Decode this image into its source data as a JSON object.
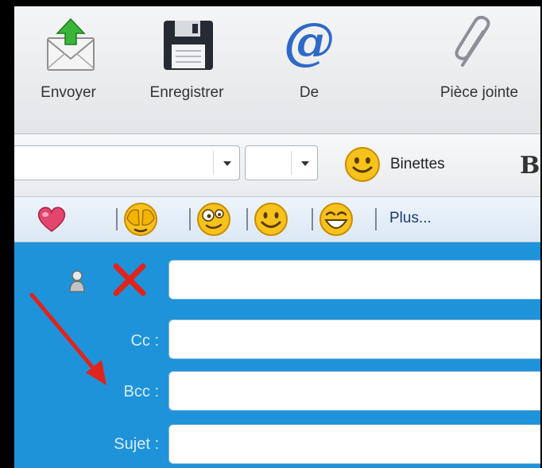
{
  "toolbar": {
    "buttons": [
      {
        "label": "Envoyer",
        "icon": "send-envelope-icon"
      },
      {
        "label": "Enregistrer",
        "icon": "floppy-disk-icon"
      },
      {
        "label": "De",
        "icon": "at-sign-icon"
      },
      {
        "label": "Pièce jointe",
        "icon": "paperclip-icon"
      }
    ]
  },
  "format_bar": {
    "font_family_value": "",
    "font_size_value": "",
    "emoticons_label": "Binettes",
    "bold_label": "B"
  },
  "emoji_bar": {
    "emojis": [
      "heart",
      "hands-over-eyes",
      "silly-face",
      "smile",
      "laughing"
    ],
    "more_label": "Plus..."
  },
  "compose": {
    "to_label": "",
    "cc_label": "Cc :",
    "bcc_label": "Bcc :",
    "subject_label": "Sujet :",
    "to_value": "",
    "cc_value": "",
    "bcc_value": "",
    "subject_value": ""
  },
  "colors": {
    "field_area_bg": "#1e93da",
    "annotation_red": "#e0241b",
    "link_blue": "#1f3a7a"
  }
}
